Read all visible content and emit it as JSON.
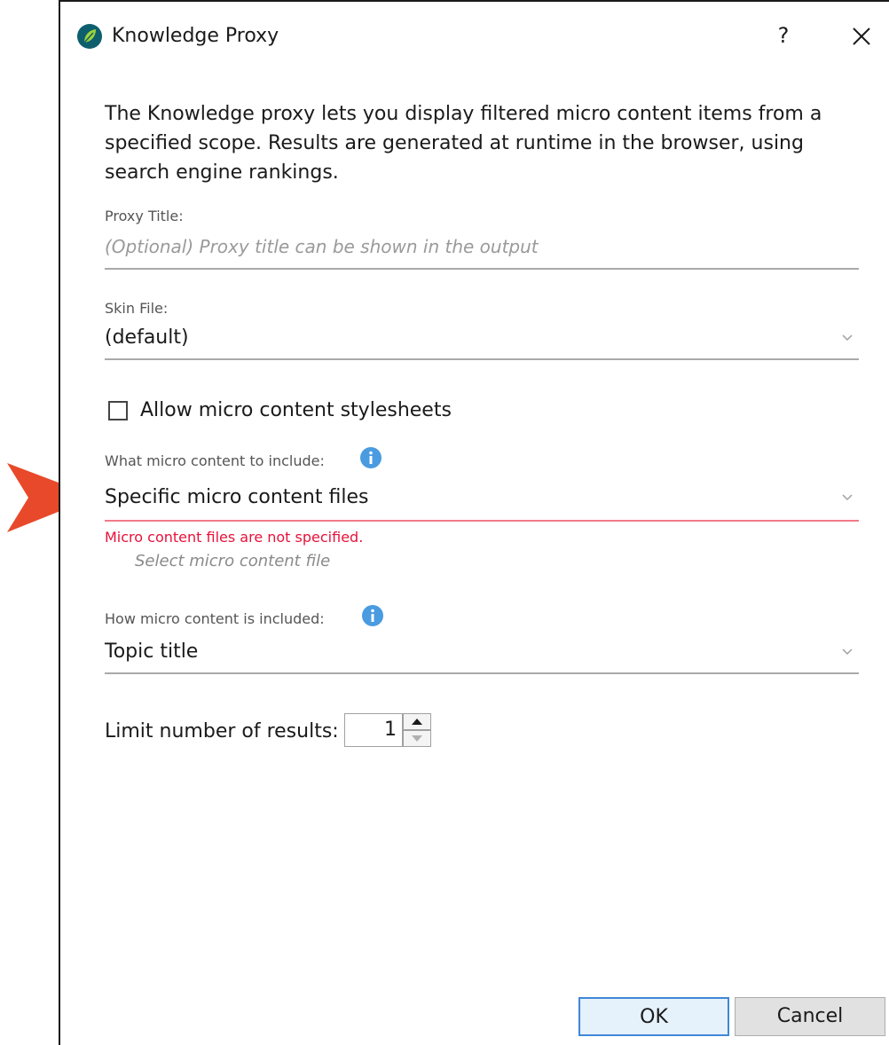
{
  "window": {
    "title": "Knowledge Proxy",
    "help_label": "?"
  },
  "description": "The Knowledge proxy lets you display filtered micro content items from a specified scope. Results are generated at runtime in the browser, using search engine rankings.",
  "proxy_title": {
    "label": "Proxy Title:",
    "placeholder": "(Optional) Proxy title can be shown in the output",
    "value": ""
  },
  "skin_file": {
    "label": "Skin File:",
    "value": "(default)"
  },
  "allow_stylesheets": {
    "label": "Allow micro content stylesheets",
    "checked": false
  },
  "micro_content_include": {
    "label": "What micro content to include:",
    "value": "Specific micro content files",
    "error": "Micro content files are not specified.",
    "select_file_label": "Select micro content file"
  },
  "how_included": {
    "label": "How micro content is included:",
    "value": "Topic title"
  },
  "limit_results": {
    "label": "Limit number of results:",
    "value": "1"
  },
  "buttons": {
    "ok_label": "OK",
    "cancel_label": "Cancel"
  },
  "colors": {
    "error": "#e8113a",
    "error_underline": "#f07a8a",
    "info_icon": "#4a9be0",
    "pointer_arrow": "#e8492a",
    "ok_border": "#3f87d6"
  },
  "icons": {
    "app": "knowledge-proxy-app-icon",
    "close": "close-icon",
    "chevron": "chevron-down-icon",
    "info": "info-icon",
    "pointer": "callout-arrow-icon"
  }
}
